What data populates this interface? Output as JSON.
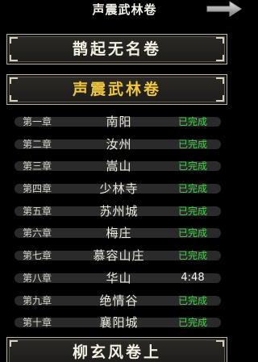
{
  "header": {
    "title": "声震武林卷",
    "forward_icon": "right-arrow-icon"
  },
  "volumes": {
    "previous": "鹊起无名卷",
    "current": "声震武林卷",
    "next": "柳玄风卷上"
  },
  "colors": {
    "completed": "#45d04a",
    "active_volume_text": "#f1c83c"
  },
  "chapters": [
    {
      "num": "第一章",
      "name": "南阳",
      "status": "已完成"
    },
    {
      "num": "第二章",
      "name": "汝州",
      "status": "已完成"
    },
    {
      "num": "第三章",
      "name": "嵩山",
      "status": "已完成"
    },
    {
      "num": "第四章",
      "name": "少林寺",
      "status": "已完成"
    },
    {
      "num": "第五章",
      "name": "苏州城",
      "status": "已完成"
    },
    {
      "num": "第六章",
      "name": "梅庄",
      "status": "已完成"
    },
    {
      "num": "第七章",
      "name": "慕容山庄",
      "status": "已完成"
    },
    {
      "num": "第八章",
      "name": "华山",
      "status": "4:48"
    },
    {
      "num": "第九章",
      "name": "绝情谷",
      "status": "已完成"
    },
    {
      "num": "第十章",
      "name": "襄阳城",
      "status": "已完成"
    }
  ]
}
